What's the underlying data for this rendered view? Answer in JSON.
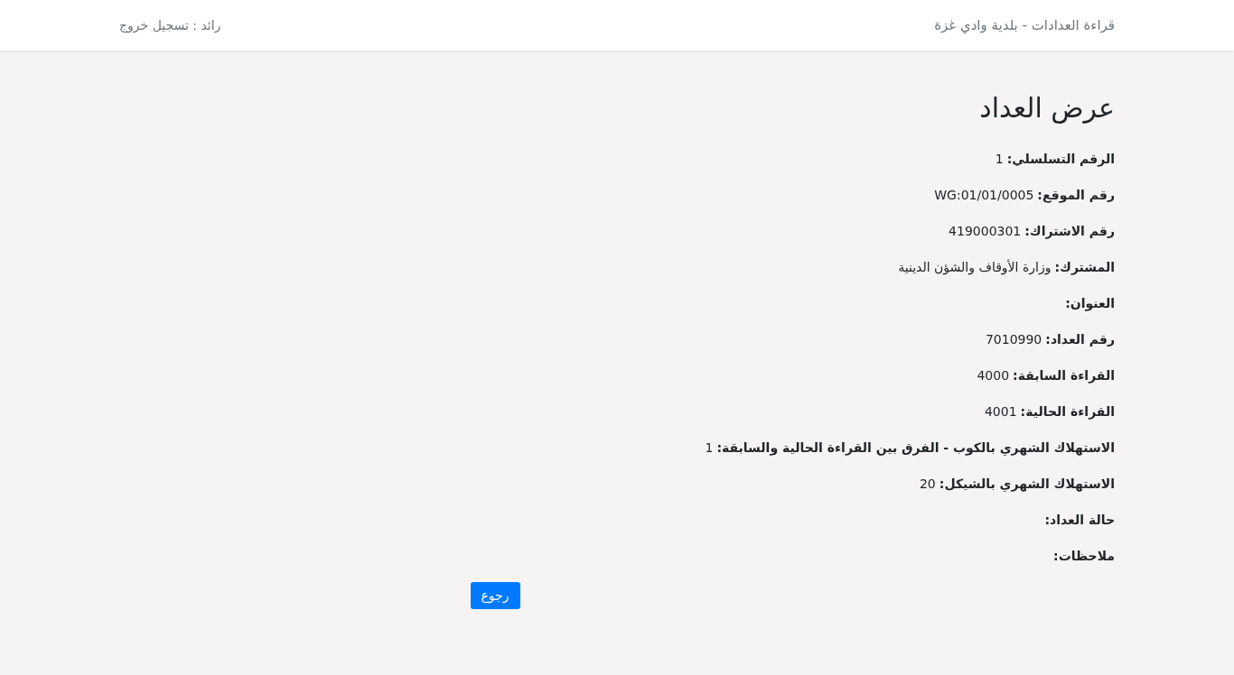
{
  "navbar": {
    "brand": "قراءة العدادات - بلدية وادي غزة",
    "user": "رائد : ",
    "logout": "تسجيل خروج"
  },
  "title": "عرض العداد",
  "fields": [
    {
      "label": "الرقم التسلسلي:",
      "value": "1"
    },
    {
      "label": "رقم الموقع:",
      "value": "WG:01/01/0005"
    },
    {
      "label": "رقم الاشتراك:",
      "value": "419000301"
    },
    {
      "label": "المشترك:",
      "value": "وزارة الأوقاف والشؤن الدينية"
    },
    {
      "label": "العنوان:"
    },
    {
      "label": "رقم العداد:",
      "value": "7010990"
    },
    {
      "label": "القراءة السابقة:",
      "value": "4000"
    },
    {
      "label": "القراءة الحالية:",
      "value": "4001"
    },
    {
      "label": "الاستهلاك الشهري بالكوب - الفرق بين القراءة الحالية والسابقة:",
      "value": "1"
    },
    {
      "label": "الاستهلاك الشهري بالشيكل:",
      "value": "20"
    },
    {
      "label": "حالة العداد:"
    },
    {
      "label": "ملاحظات:"
    }
  ],
  "back_button": "رجوع"
}
